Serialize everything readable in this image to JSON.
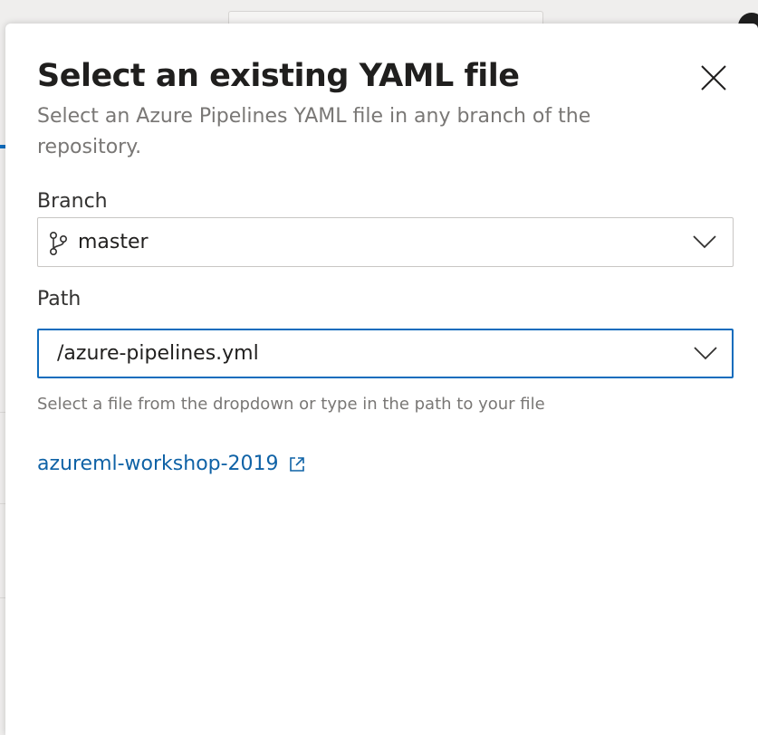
{
  "dialog": {
    "title": "Select an existing YAML file",
    "subtitle": "Select an Azure Pipelines YAML file in any branch of the repository."
  },
  "branch": {
    "label": "Branch",
    "value": "master",
    "icon": "git-branch-icon"
  },
  "path": {
    "label": "Path",
    "value": "/azure-pipelines.yml",
    "hint": "Select a file from the dropdown or type in the path to your file"
  },
  "repository": {
    "link_text": "azureml-workshop-2019",
    "icon": "open-in-new-window-icon"
  },
  "colors": {
    "accent": "#0f6cbd",
    "link": "#0f62a6",
    "title": "#201f1e",
    "secondary_text": "#797775"
  }
}
